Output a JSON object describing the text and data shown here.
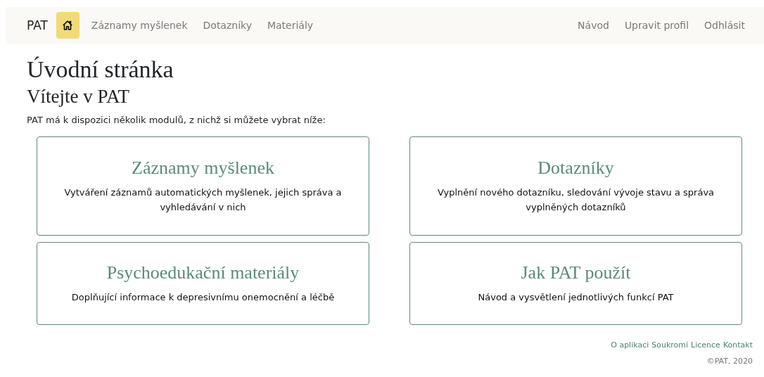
{
  "navbar": {
    "brand": "PAT",
    "home": {
      "selected": true
    },
    "links": [
      "Záznamy myšlenek",
      "Dotazníky",
      "Materiály"
    ],
    "right_links": [
      "Návod",
      "Upravit profil",
      "Odhlásit"
    ]
  },
  "title": "Úvodní stránka",
  "subtitle": "Vítejte v PAT",
  "intro": "PAT má k dispozici několik modulů, z nichž si můžete vybrat níže:",
  "cards": [
    {
      "title": "Záznamy myšlenek",
      "text": "Vytváření záznamů automatických myšlenek, jejich správa a vyhledávání v nich"
    },
    {
      "title": "Dotazníky",
      "text": "Vyplnění nového dotazníku, sledování vývoje stavu a správa vyplněných dotazníků"
    },
    {
      "title": "Psychoedukační materiály",
      "text": "Doplňující informace k depresivnímu onemocnění a léčbě"
    },
    {
      "title": "Jak PAT použít",
      "text": "Návod a vysvětlení jednotlivých funkcí PAT"
    }
  ],
  "footer": {
    "links": [
      "O aplikaci",
      "Soukromí",
      "Licence",
      "Kontakt"
    ],
    "copyright": "©PAT, 2020"
  }
}
